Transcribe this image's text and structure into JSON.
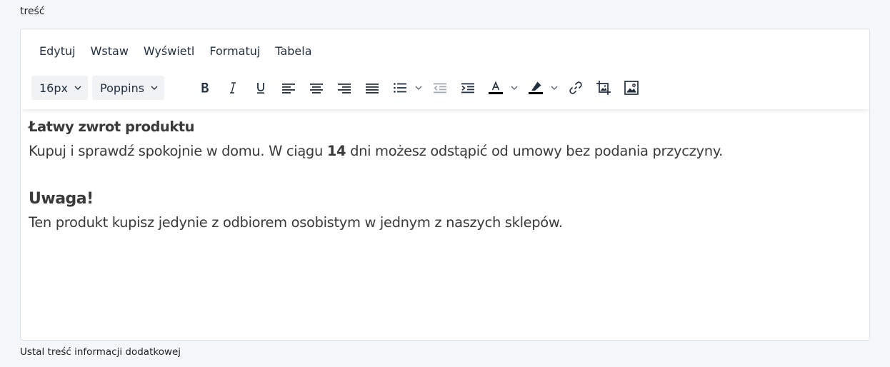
{
  "field": {
    "label": "treść",
    "helper": "Ustal treść informacji dodatkowej"
  },
  "menubar": {
    "items": [
      "Edytuj",
      "Wstaw",
      "Wyświetl",
      "Formatuj",
      "Tabela"
    ]
  },
  "toolbar": {
    "font_size": "16px",
    "font_family": "Poppins",
    "buttons": [
      {
        "icon": "bold-icon"
      },
      {
        "icon": "italic-icon"
      },
      {
        "icon": "underline-icon"
      },
      {
        "icon": "align-left-icon"
      },
      {
        "icon": "align-center-icon"
      },
      {
        "icon": "align-right-icon"
      },
      {
        "icon": "align-justify-icon"
      },
      {
        "icon": "bullet-list-icon"
      },
      {
        "icon": "outdent-icon"
      },
      {
        "icon": "indent-icon"
      },
      {
        "icon": "text-color-icon"
      },
      {
        "icon": "highlight-color-icon"
      },
      {
        "icon": "link-icon"
      },
      {
        "icon": "crop-image-icon"
      },
      {
        "icon": "image-icon"
      }
    ]
  },
  "content": {
    "heading1": "Łatwy zwrot produktu",
    "para1_before": "Kupuj i sprawdź spokojnie w domu. W ciągu ",
    "para1_bold": "14",
    "para1_after": " dni możesz odstąpić od umowy bez podania przyczyny.",
    "heading2": "Uwaga!",
    "para2": "Ten produkt kupisz jedynie z odbiorem osobistym w jednym z naszych sklepów."
  },
  "colors": {
    "page_bg": "#f4f7fa",
    "editor_border": "#dde1e6",
    "toolbar_text": "#222f3e",
    "content_text": "#3a3a3a",
    "disabled_icon": "#a6acb3"
  }
}
